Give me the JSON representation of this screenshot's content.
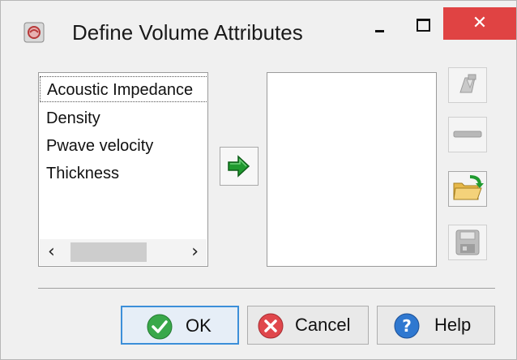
{
  "window": {
    "title": "Define Volume Attributes",
    "close_symbol": "✕",
    "accent_close": "#e04343"
  },
  "source_list": {
    "items": [
      {
        "label": "Acoustic Impedance",
        "selected": true
      },
      {
        "label": "Density"
      },
      {
        "label": "Pwave velocity"
      },
      {
        "label": "Thickness"
      }
    ],
    "scroll_left": "‹",
    "scroll_right": "›"
  },
  "target_list": {
    "items": []
  },
  "icons": {
    "app": "app-icon",
    "add": "green-arrow-right-icon",
    "side": [
      "pencil-edit-icon",
      "remove-dash-icon",
      "open-folder-icon",
      "save-floppy-icon"
    ]
  },
  "buttons": {
    "ok_label": "OK",
    "cancel_label": "Cancel",
    "help_label": "Help"
  }
}
